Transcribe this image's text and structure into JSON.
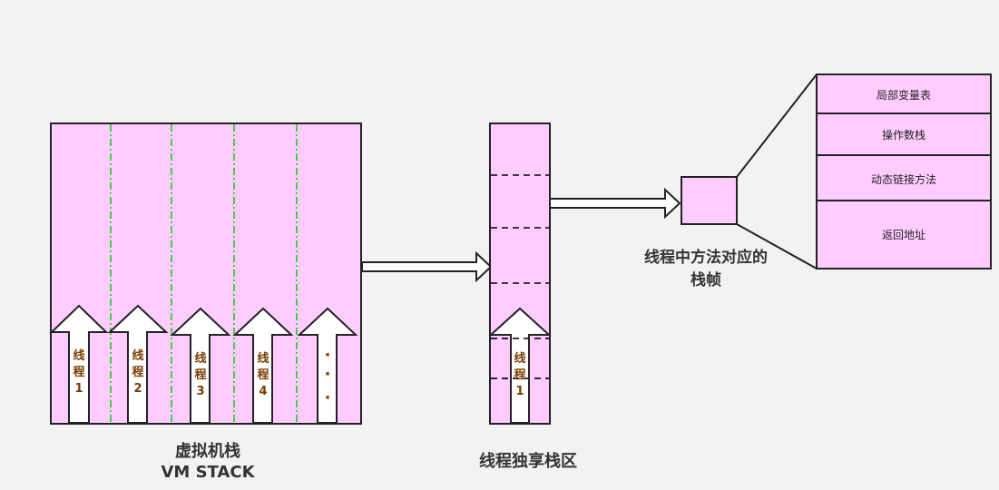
{
  "colors": {
    "background": "#f2f2f2",
    "pink": "#ffccff",
    "stroke": "#222222",
    "green_divider": "#33cc33",
    "thread_label": "#7a3b00"
  },
  "vm_stack": {
    "title_cn": "虚拟机栈",
    "title_en": "VM STACK",
    "threads": [
      {
        "chars": [
          "线",
          "程",
          "1"
        ]
      },
      {
        "chars": [
          "线",
          "程",
          "2"
        ]
      },
      {
        "chars": [
          "线",
          "程",
          "3"
        ]
      },
      {
        "chars": [
          "线",
          "程",
          "4"
        ]
      },
      {
        "chars": [
          "·",
          "·",
          "·"
        ]
      }
    ]
  },
  "thread_stack": {
    "title": "线程独享栈区",
    "thread": {
      "chars": [
        "线",
        "程",
        "1"
      ]
    }
  },
  "method_frame": {
    "label_line1": "线程中方法对应的",
    "label_line2": "栈帧"
  },
  "frame_parts": [
    {
      "label": "局部变量表"
    },
    {
      "label": "操作数栈"
    },
    {
      "label": "动态链接方法"
    },
    {
      "label": "返回地址"
    }
  ]
}
